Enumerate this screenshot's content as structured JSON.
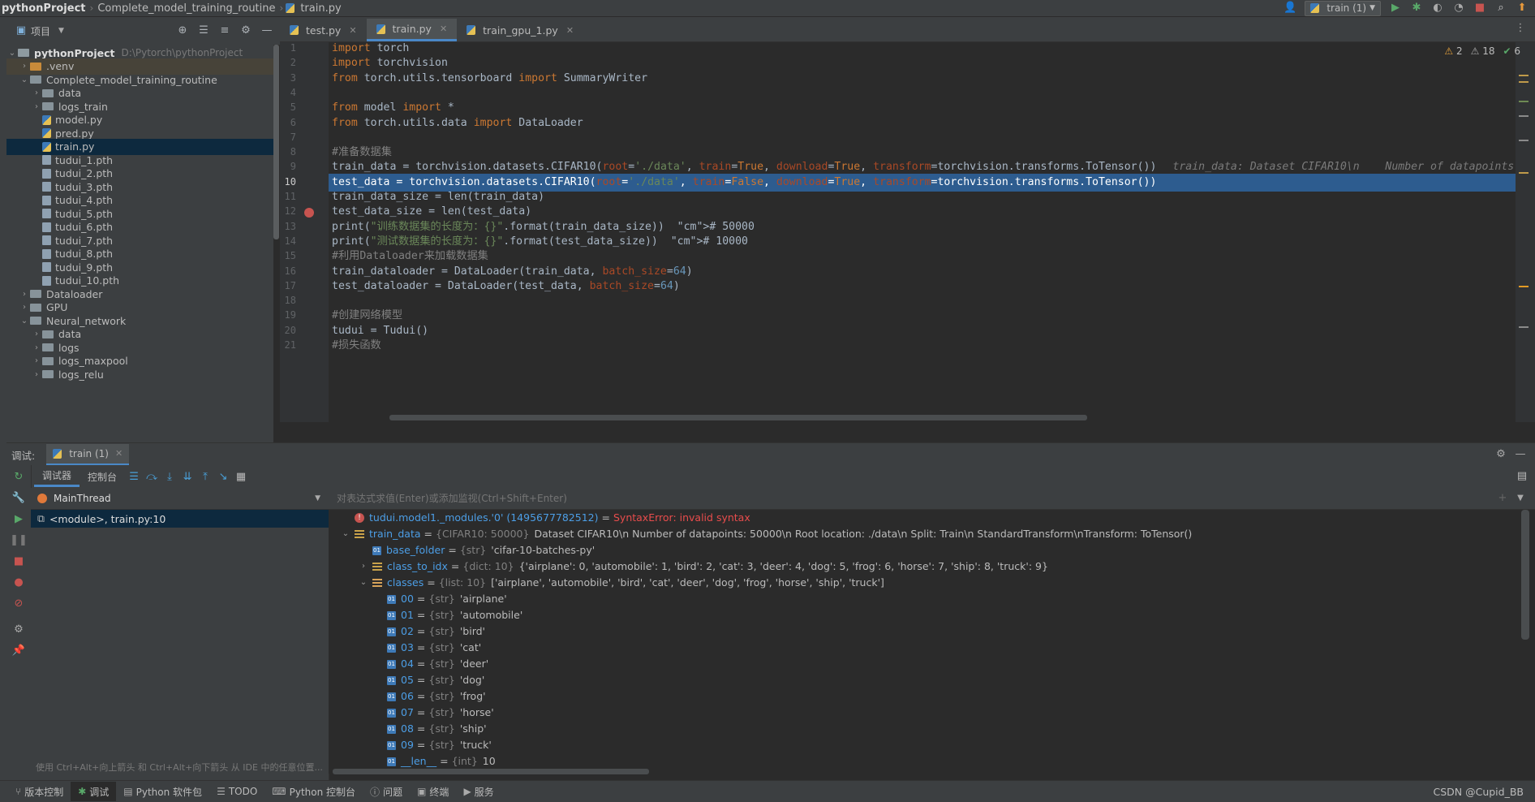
{
  "breadcrumb": {
    "project": "pythonProject",
    "folder": "Complete_model_training_routine",
    "file": "train.py"
  },
  "toolbar": {
    "run_config": "train (1)"
  },
  "project_panel": {
    "title": "项目",
    "root": {
      "name": "pythonProject",
      "path": "D:\\Pytorch\\pythonProject"
    },
    "items": [
      {
        "label": ".venv",
        "kind": "folder-orange",
        "depth": 1,
        "state": "collapsed"
      },
      {
        "label": "Complete_model_training_routine",
        "kind": "folder",
        "depth": 1,
        "state": "expanded"
      },
      {
        "label": "data",
        "kind": "folder",
        "depth": 2,
        "state": "collapsed"
      },
      {
        "label": "logs_train",
        "kind": "folder",
        "depth": 2,
        "state": "collapsed"
      },
      {
        "label": "model.py",
        "kind": "py",
        "depth": 2
      },
      {
        "label": "pred.py",
        "kind": "py",
        "depth": 2
      },
      {
        "label": "train.py",
        "kind": "py",
        "depth": 2,
        "selected": true
      },
      {
        "label": "tudui_1.pth",
        "kind": "pth",
        "depth": 2
      },
      {
        "label": "tudui_2.pth",
        "kind": "pth",
        "depth": 2
      },
      {
        "label": "tudui_3.pth",
        "kind": "pth",
        "depth": 2
      },
      {
        "label": "tudui_4.pth",
        "kind": "pth",
        "depth": 2
      },
      {
        "label": "tudui_5.pth",
        "kind": "pth",
        "depth": 2
      },
      {
        "label": "tudui_6.pth",
        "kind": "pth",
        "depth": 2
      },
      {
        "label": "tudui_7.pth",
        "kind": "pth",
        "depth": 2
      },
      {
        "label": "tudui_8.pth",
        "kind": "pth",
        "depth": 2
      },
      {
        "label": "tudui_9.pth",
        "kind": "pth",
        "depth": 2
      },
      {
        "label": "tudui_10.pth",
        "kind": "pth",
        "depth": 2
      },
      {
        "label": "Dataloader",
        "kind": "folder",
        "depth": 1,
        "state": "collapsed"
      },
      {
        "label": "GPU",
        "kind": "folder",
        "depth": 1,
        "state": "collapsed"
      },
      {
        "label": "Neural_network",
        "kind": "folder",
        "depth": 1,
        "state": "expanded"
      },
      {
        "label": "data",
        "kind": "folder",
        "depth": 2,
        "state": "collapsed"
      },
      {
        "label": "logs",
        "kind": "folder",
        "depth": 2,
        "state": "collapsed"
      },
      {
        "label": "logs_maxpool",
        "kind": "folder",
        "depth": 2,
        "state": "collapsed"
      },
      {
        "label": "logs_relu",
        "kind": "folder",
        "depth": 2,
        "state": "collapsed"
      }
    ]
  },
  "editor": {
    "tabs": [
      {
        "label": "test.py",
        "active": false
      },
      {
        "label": "train.py",
        "active": true
      },
      {
        "label": "train_gpu_1.py",
        "active": false
      }
    ],
    "inspections": {
      "warnings": "2",
      "weak_warnings": "18",
      "ok": "6"
    },
    "highlighted_line": 10,
    "lines": [
      "import torch",
      "import torchvision",
      "from torch.utils.tensorboard import SummaryWriter",
      "",
      "from model import *",
      "from torch.utils.data import DataLoader",
      "",
      "#准备数据集",
      "train_data = torchvision.datasets.CIFAR10(root='./data', train=True, download=True, transform=torchvision.transforms.ToTensor())",
      "test_data = torchvision.datasets.CIFAR10(root='./data', train=False, download=True, transform=torchvision.transforms.ToTensor())",
      "train_data_size = len(train_data)",
      "test_data_size = len(test_data)",
      "print(\"训练数据集的长度为：{}\".format(train_data_size))  # 50000",
      "print(\"测试数据集的长度为：{}\".format(test_data_size))  # 10000",
      "#利用Dataloader来加载数据集",
      "train_dataloader = DataLoader(train_data, batch_size=64)",
      "test_dataloader = DataLoader(test_data, batch_size=64)",
      "",
      "#创建网络模型",
      "tudui = Tudui()",
      "#损失函数"
    ],
    "inline_hint": "train_data: Dataset CIFAR10\\n    Number of datapoints:"
  },
  "debug": {
    "label": "调试:",
    "session_tab": "train (1)",
    "tabs": [
      "调试器",
      "控制台"
    ],
    "thread": "MainThread",
    "frame": "<module>, train.py:10",
    "frames_hint": "使用 Ctrl+Alt+向上箭头 和 Ctrl+Alt+向下箭头 从 IDE 中的任意位置...",
    "eval_placeholder": "对表达式求值(Enter)或添加监视(Ctrl+Shift+Enter)",
    "vars": {
      "error": {
        "name": "tudui.model1._modules.'0' (1495677782512)",
        "value": "SyntaxError: invalid syntax"
      },
      "train_data": {
        "name": "train_data",
        "type": "{CIFAR10: 50000}",
        "value": "Dataset CIFAR10\\n    Number of datapoints: 50000\\n    Root location: ./data\\n    Split: Train\\n    StandardTransform\\nTransform: ToTensor()"
      },
      "base_folder": {
        "name": "base_folder",
        "type": "{str}",
        "value": "'cifar-10-batches-py'"
      },
      "class_to_idx": {
        "name": "class_to_idx",
        "type": "{dict: 10}",
        "value": "{'airplane': 0, 'automobile': 1, 'bird': 2, 'cat': 3, 'deer': 4, 'dog': 5, 'frog': 6, 'horse': 7, 'ship': 8, 'truck': 9}"
      },
      "classes": {
        "name": "classes",
        "type": "{list: 10}",
        "value": "['airplane', 'automobile', 'bird', 'cat', 'deer', 'dog', 'frog', 'horse', 'ship', 'truck']"
      },
      "class_items": [
        {
          "idx": "00",
          "value": "'airplane'"
        },
        {
          "idx": "01",
          "value": "'automobile'"
        },
        {
          "idx": "02",
          "value": "'bird'"
        },
        {
          "idx": "03",
          "value": "'cat'"
        },
        {
          "idx": "04",
          "value": "'deer'"
        },
        {
          "idx": "05",
          "value": "'dog'"
        },
        {
          "idx": "06",
          "value": "'frog'"
        },
        {
          "idx": "07",
          "value": "'horse'"
        },
        {
          "idx": "08",
          "value": "'ship'"
        },
        {
          "idx": "09",
          "value": "'truck'"
        }
      ],
      "len": {
        "name": "__len__",
        "type": "{int}",
        "value": "10"
      }
    }
  },
  "statusbar": {
    "items": [
      "版本控制",
      "调试",
      "Python 软件包",
      "TODO",
      "Python 控制台",
      "问题",
      "终端",
      "服务"
    ],
    "active": "调试",
    "credit": "CSDN @Cupid_BB"
  }
}
